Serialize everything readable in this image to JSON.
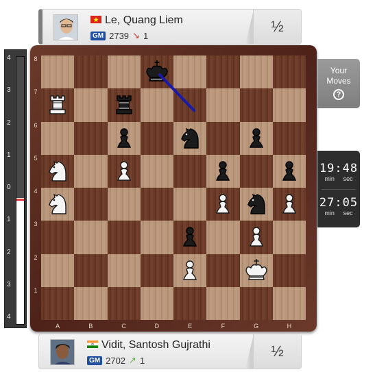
{
  "top_player": {
    "name": "Le, Quang Liem",
    "flag": "vietnam-flag",
    "title": "GM",
    "rating": "2739",
    "rating_change": "1",
    "rating_direction": "down",
    "result": "½"
  },
  "bottom_player": {
    "name": "Vidit, Santosh Gujrathi",
    "flag": "india-flag",
    "title": "GM",
    "rating": "2702",
    "rating_change": "1",
    "rating_direction": "up",
    "result": "½"
  },
  "eval_bar": {
    "ticks": [
      "4",
      "3",
      "2",
      "1",
      "0",
      "1",
      "2",
      "3",
      "4"
    ],
    "white_fraction": 0.47
  },
  "your_moves": {
    "line1": "Your",
    "line2": "Moves",
    "icon": "question-icon"
  },
  "clocks": {
    "top": {
      "time": "19:48",
      "unit_min": "min",
      "unit_sec": "sec"
    },
    "bottom": {
      "time": "27:05",
      "unit_min": "min",
      "unit_sec": "sec"
    }
  },
  "board": {
    "ranks": [
      "8",
      "7",
      "6",
      "5",
      "4",
      "3",
      "2",
      "1"
    ],
    "files": [
      "A",
      "B",
      "C",
      "D",
      "E",
      "F",
      "G",
      "H"
    ],
    "pieces": [
      {
        "square": "d8",
        "type": "king",
        "color": "black"
      },
      {
        "square": "a7",
        "type": "rook",
        "color": "white"
      },
      {
        "square": "c7",
        "type": "rook",
        "color": "black"
      },
      {
        "square": "c6",
        "type": "pawn",
        "color": "black"
      },
      {
        "square": "e6",
        "type": "knight",
        "color": "black"
      },
      {
        "square": "g6",
        "type": "pawn",
        "color": "black"
      },
      {
        "square": "a5",
        "type": "knight",
        "color": "white"
      },
      {
        "square": "c5",
        "type": "pawn",
        "color": "white"
      },
      {
        "square": "f5",
        "type": "pawn",
        "color": "black"
      },
      {
        "square": "h5",
        "type": "pawn",
        "color": "black"
      },
      {
        "square": "a4",
        "type": "knight",
        "color": "white"
      },
      {
        "square": "f4",
        "type": "pawn",
        "color": "white"
      },
      {
        "square": "g4",
        "type": "knight",
        "color": "black"
      },
      {
        "square": "h4",
        "type": "pawn",
        "color": "white"
      },
      {
        "square": "e3",
        "type": "pawn",
        "color": "black"
      },
      {
        "square": "g3",
        "type": "pawn",
        "color": "white"
      },
      {
        "square": "e2",
        "type": "pawn",
        "color": "white"
      },
      {
        "square": "g2",
        "type": "king",
        "color": "white"
      }
    ],
    "arrow": {
      "from": "e7",
      "to": "d8",
      "color": "#1a1aa8"
    }
  }
}
